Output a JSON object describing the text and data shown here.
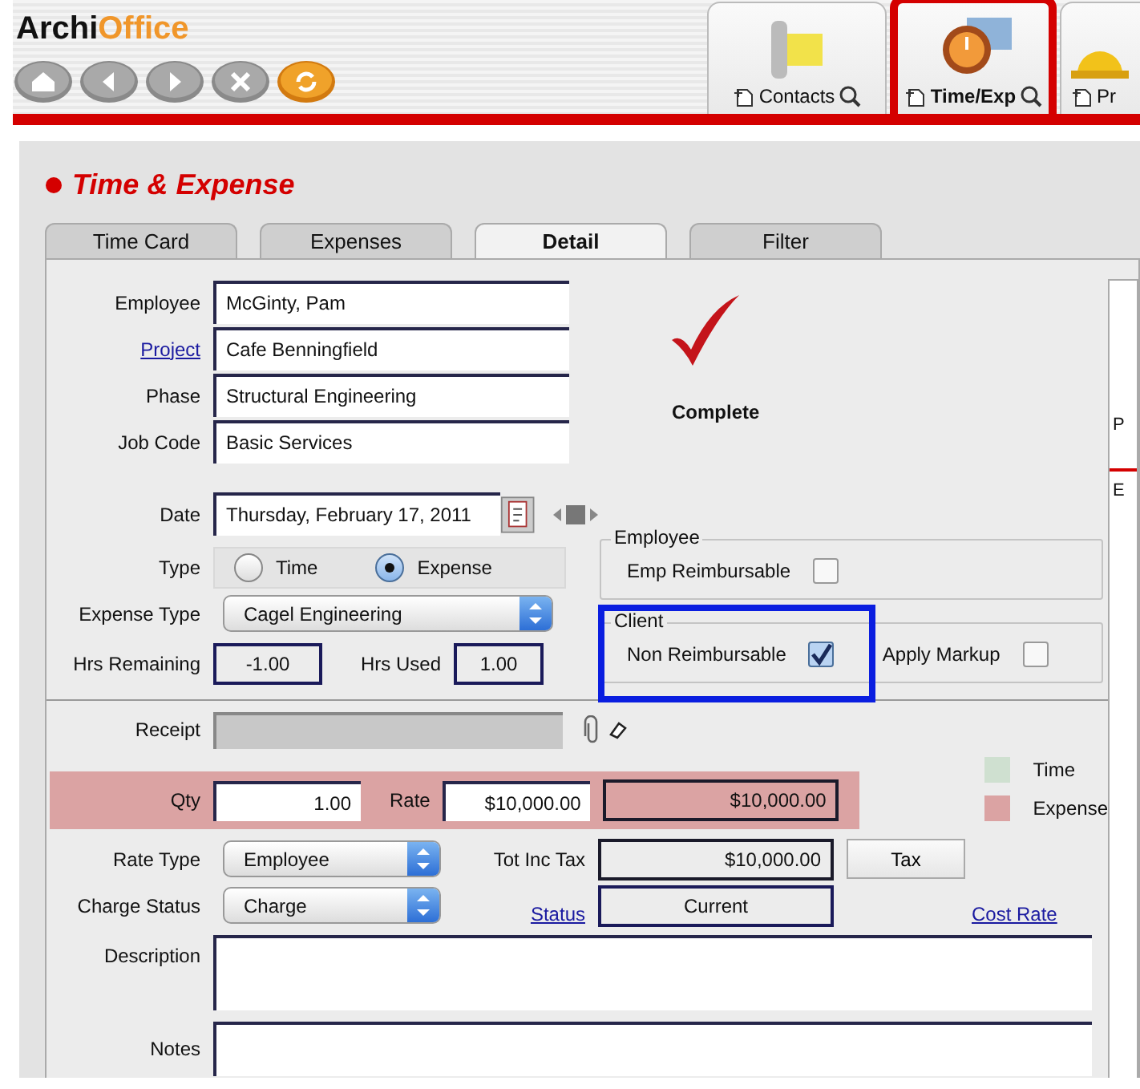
{
  "logo": {
    "text_dark": "Archi",
    "text_accent": "Office"
  },
  "nav_buttons": [
    {
      "kind": "home"
    },
    {
      "kind": "back"
    },
    {
      "kind": "forward"
    },
    {
      "kind": "stop"
    },
    {
      "kind": "refresh"
    }
  ],
  "module_tabs": [
    {
      "label": "Contacts",
      "kind": "contacts",
      "selected": false
    },
    {
      "label": "Time/Exp",
      "kind": "time",
      "selected": true
    },
    {
      "label": "Pr",
      "kind": "projects",
      "selected": false
    }
  ],
  "page_title": "Time & Expense",
  "tabs": [
    {
      "label": "Time Card",
      "selected": false
    },
    {
      "label": "Expenses",
      "selected": false
    },
    {
      "label": "Detail",
      "selected": true
    },
    {
      "label": "Filter",
      "selected": false
    }
  ],
  "header_fields": [
    {
      "label": "Employee",
      "link": false,
      "value": "McGinty, Pam"
    },
    {
      "label": "Project",
      "link": true,
      "value": "Cafe Benningfield"
    },
    {
      "label": "Phase",
      "link": false,
      "value": "Structural Engineering"
    },
    {
      "label": "Job Code",
      "link": false,
      "value": "Basic Services"
    }
  ],
  "status": {
    "label": "Complete",
    "complete": true
  },
  "date": {
    "label": "Date",
    "value": "Thursday, February 17, 2011"
  },
  "type": {
    "label": "Type",
    "options": [
      {
        "label": "Time",
        "selected": false
      },
      {
        "label": "Expense",
        "selected": true
      }
    ]
  },
  "expense_type": {
    "label": "Expense Type",
    "value": "Cagel Engineering"
  },
  "hrs_remaining": {
    "label": "Hrs Remaining",
    "value": "-1.00"
  },
  "hrs_used": {
    "label": "Hrs Used",
    "value": "1.00"
  },
  "employee_group": {
    "legend": "Employee",
    "options": [
      {
        "label": "Emp Reimbursable",
        "checked": false
      }
    ]
  },
  "client_group": {
    "legend": "Client",
    "highlighted": true,
    "options": [
      {
        "label": "Non Reimbursable",
        "checked": true
      },
      {
        "label": "Apply Markup",
        "checked": false
      }
    ]
  },
  "receipt": {
    "label": "Receipt"
  },
  "qty": {
    "label": "Qty",
    "value": "1.00"
  },
  "rate": {
    "label": "Rate",
    "value": "$10,000.00"
  },
  "amount": "$10,000.00",
  "legend": [
    {
      "label": "Time",
      "color": "#cfe0d0"
    },
    {
      "label": "Expense",
      "color": "#dba3a3"
    }
  ],
  "rate_type": {
    "label": "Rate Type",
    "value": "Employee"
  },
  "tot_inc_tax": {
    "label": "Tot Inc Tax",
    "value": "$10,000.00"
  },
  "tax_button": "Tax",
  "charge_status": {
    "label": "Charge Status",
    "value": "Charge"
  },
  "status_field": {
    "label": "Status",
    "value": "Current"
  },
  "cost_rate": "Cost Rate",
  "description": {
    "label": "Description"
  },
  "notes": {
    "label": "Notes"
  },
  "side_panel": {
    "texts": [
      "P",
      "E"
    ]
  }
}
